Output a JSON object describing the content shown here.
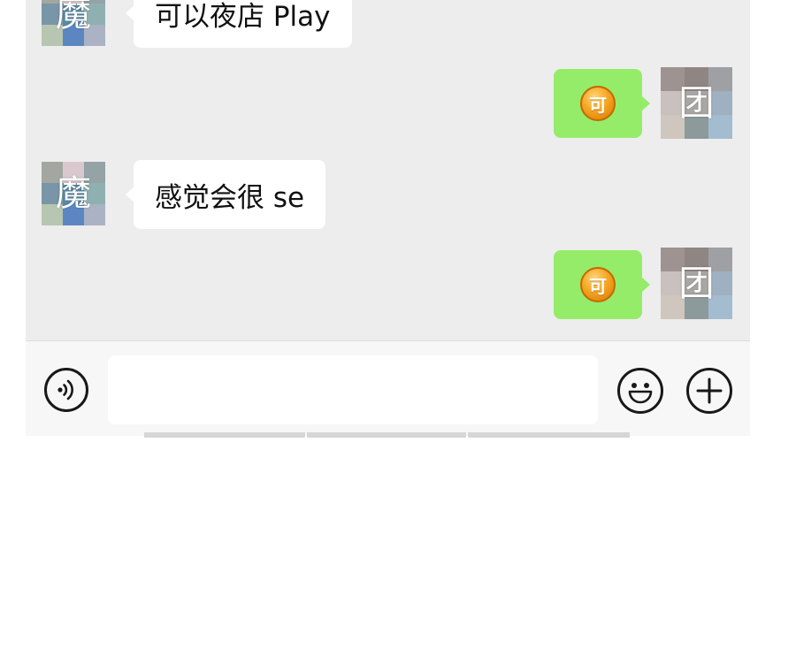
{
  "messages": [
    {
      "side": "left",
      "avatar_glyph": "魔",
      "text": "可以夜店 Play"
    },
    {
      "side": "right",
      "avatar_glyph": "团",
      "emoji_glyph": "可"
    },
    {
      "side": "left",
      "avatar_glyph": "魔",
      "text": "感觉会很 se"
    },
    {
      "side": "right",
      "avatar_glyph": "团",
      "emoji_glyph": "可"
    }
  ],
  "avatar_colors": {
    "left": [
      "#a3a7a0",
      "#d9c9cf",
      "#93a3a6",
      "#7896a8",
      "#5b8aa3",
      "#8fb0b0",
      "#b7c6b0",
      "#5c86c2",
      "#aab2c4"
    ],
    "right": [
      "#9e9390",
      "#8f8683",
      "#9ea0a4",
      "#c9c1bd",
      "#a9a6a4",
      "#9fb0c0",
      "#cfc6bd",
      "#8c9a9c",
      "#a3bcd0"
    ]
  },
  "input_bar": {
    "voice_icon": "voice-icon",
    "input_value": "",
    "emoji_icon": "emoji-icon",
    "plus_icon": "plus-icon"
  },
  "colors": {
    "chat_background": "#ededed",
    "sent_bubble": "#95ec69",
    "received_bubble": "#ffffff"
  }
}
